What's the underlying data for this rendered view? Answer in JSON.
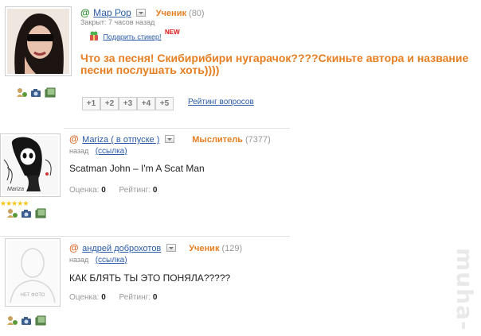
{
  "question": {
    "author": "Мар Рор",
    "rank": "Ученик",
    "rank_points": "(80)",
    "status": "Закрыт: 7 часов назад",
    "sticker_link": "Подарить стикер!",
    "new_badge": "NEW",
    "text": "Что за песня! Скибирибири нугарачок????Скиньте автора и название песни послушать хоть))))",
    "votes": [
      "+1",
      "+2",
      "+3",
      "+4",
      "+5"
    ],
    "rating_link": "Рейтинг вопросов"
  },
  "answers": [
    {
      "author": "Mariza ( в отпуске )",
      "rank": "Мыслитель",
      "rank_points": "(7377)",
      "time": "назад",
      "link": "(ссылка)",
      "text": "Scatman John – I'm A Scat Man",
      "score_label": "Оценка:",
      "score_value": "0",
      "rating_label": "Рейтинг:",
      "rating_value": "0",
      "avatar_caption": "Mariza"
    },
    {
      "author": "андрей доброхотов",
      "rank": "Ученик",
      "rank_points": "(129)",
      "time": "назад",
      "link": "(ссылка)",
      "text": "КАК БЛЯТЬ ТЫ ЭТО ПОНЯЛА?????",
      "score_label": "Оценка:",
      "score_value": "0",
      "rating_label": "Рейтинг:",
      "rating_value": "0",
      "avatar_caption": "НЕТ ФОТО"
    }
  ],
  "at_symbol": "@",
  "watermark": "muha-",
  "icons": [
    "user-add-icon",
    "camera-icon",
    "photo-icon",
    "gift-icon",
    "dropdown-icon",
    "star-icon"
  ],
  "colors": {
    "question_orange": "#e67e22",
    "link_blue": "#2a5aa8",
    "at_green": "#2a8a2a",
    "new_red": "#d11111"
  }
}
